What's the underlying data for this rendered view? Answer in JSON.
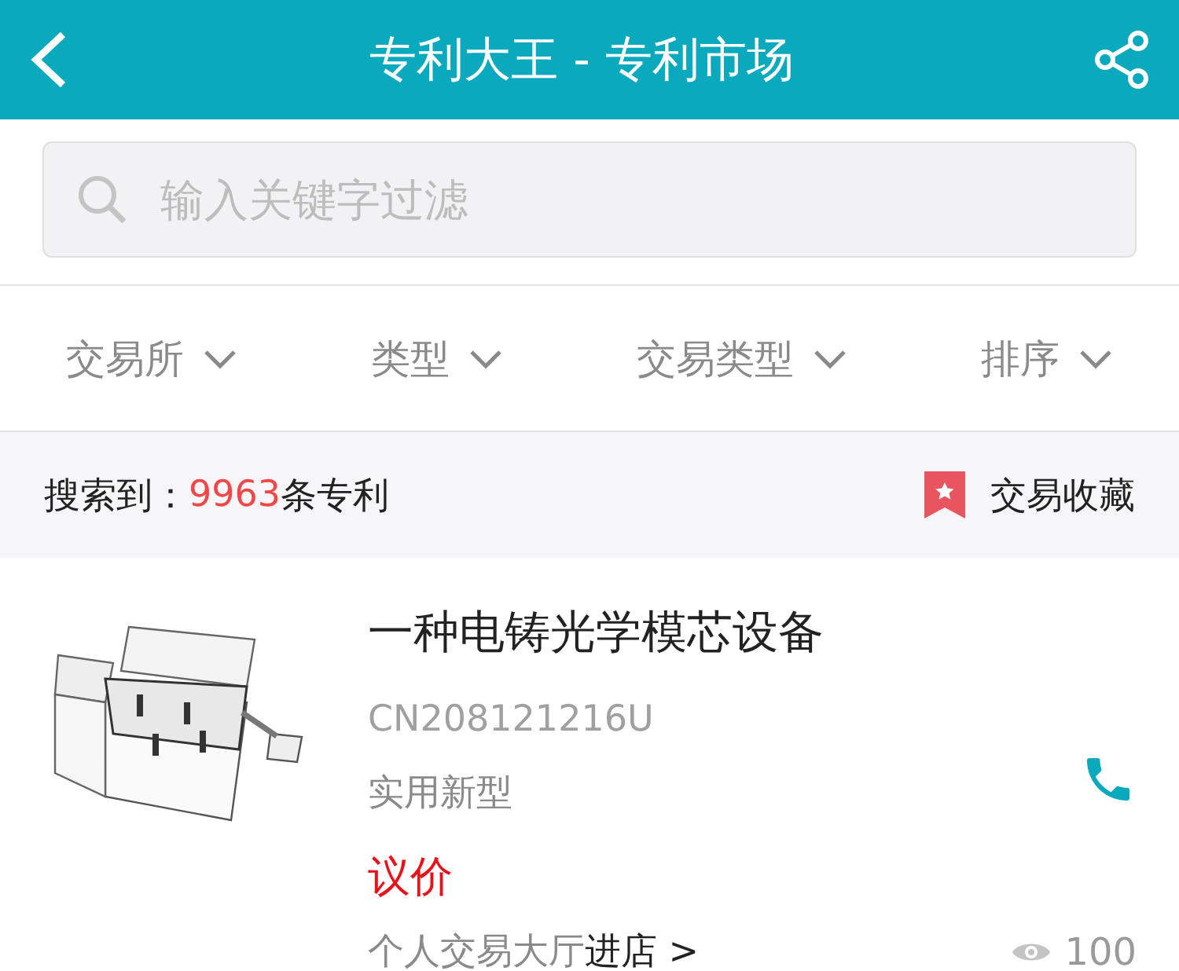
{
  "header": {
    "title": "专利大王 - 专利市场"
  },
  "search": {
    "placeholder": "输入关键字过滤"
  },
  "filters": [
    {
      "label": "交易所"
    },
    {
      "label": "类型"
    },
    {
      "label": "交易类型"
    },
    {
      "label": "排序"
    }
  ],
  "summary": {
    "prefix": "搜索到：",
    "count": "9963",
    "suffix": "条专利",
    "favorites": "交易收藏"
  },
  "listings": [
    {
      "title": "一种电铸光学模芯设备",
      "number": "CN208121216U",
      "type": "实用新型",
      "price": "议价",
      "seller": "个人交易大厅",
      "shop_link": "进店 >",
      "views": "100"
    }
  ]
}
